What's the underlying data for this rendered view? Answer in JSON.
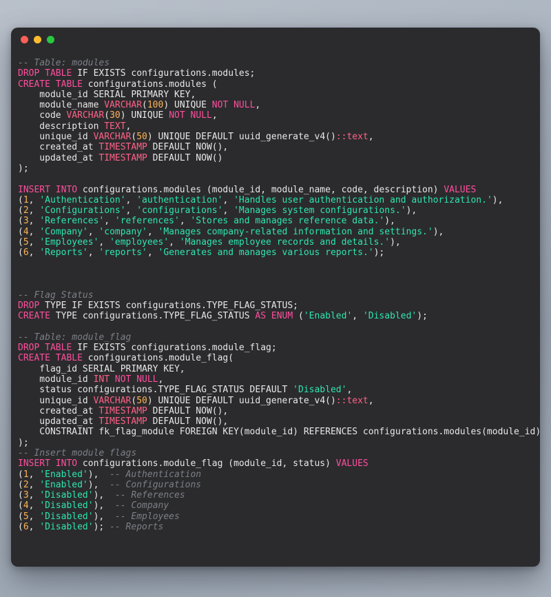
{
  "window": {
    "title": "",
    "traffic_lights": [
      {
        "name": "close",
        "color": "#ff5f57"
      },
      {
        "name": "minimize",
        "color": "#febc2e"
      },
      {
        "name": "maximize",
        "color": "#28c840"
      }
    ]
  },
  "theme": {
    "background_surface": "#2b2b2d",
    "desktop_gradient_start": "#b9c0ca",
    "desktop_gradient_end": "#a9b2bd",
    "keyword": "#ff4f9e",
    "type": "#ff6188",
    "string": "#2ee6b0",
    "number": "#ffb454",
    "comment": "#7b7f86",
    "plain": "#e8e8e8"
  },
  "code": {
    "language": "sql",
    "lines": [
      [
        {
          "t": "-- Table: modules",
          "c": "cmt"
        }
      ],
      [
        {
          "t": "DROP TABLE",
          "c": "kw"
        },
        {
          "t": " IF EXISTS configurations.modules;",
          "c": "pln"
        }
      ],
      [
        {
          "t": "CREATE TABLE",
          "c": "kw"
        },
        {
          "t": " configurations.modules (",
          "c": "pln"
        }
      ],
      [
        {
          "t": "    module_id SERIAL PRIMARY KEY,",
          "c": "pln"
        }
      ],
      [
        {
          "t": "    module_name ",
          "c": "pln"
        },
        {
          "t": "VARCHAR",
          "c": "typ"
        },
        {
          "t": "(",
          "c": "pln"
        },
        {
          "t": "100",
          "c": "num"
        },
        {
          "t": ") UNIQUE ",
          "c": "pln"
        },
        {
          "t": "NOT NULL",
          "c": "kw"
        },
        {
          "t": ",",
          "c": "pln"
        }
      ],
      [
        {
          "t": "    code ",
          "c": "pln"
        },
        {
          "t": "VARCHAR",
          "c": "typ"
        },
        {
          "t": "(",
          "c": "pln"
        },
        {
          "t": "30",
          "c": "num"
        },
        {
          "t": ") UNIQUE ",
          "c": "pln"
        },
        {
          "t": "NOT NULL",
          "c": "kw"
        },
        {
          "t": ",",
          "c": "pln"
        }
      ],
      [
        {
          "t": "    description ",
          "c": "pln"
        },
        {
          "t": "TEXT",
          "c": "typ"
        },
        {
          "t": ",",
          "c": "pln"
        }
      ],
      [
        {
          "t": "    unique_id ",
          "c": "pln"
        },
        {
          "t": "VARCHAR",
          "c": "typ"
        },
        {
          "t": "(",
          "c": "pln"
        },
        {
          "t": "50",
          "c": "num"
        },
        {
          "t": ") UNIQUE DEFAULT uuid_generate_v4()",
          "c": "pln"
        },
        {
          "t": "::text",
          "c": "typ"
        },
        {
          "t": ",",
          "c": "pln"
        }
      ],
      [
        {
          "t": "    created_at ",
          "c": "pln"
        },
        {
          "t": "TIMESTAMP",
          "c": "typ"
        },
        {
          "t": " DEFAULT NOW(),",
          "c": "pln"
        }
      ],
      [
        {
          "t": "    updated_at ",
          "c": "pln"
        },
        {
          "t": "TIMESTAMP",
          "c": "typ"
        },
        {
          "t": " DEFAULT NOW()",
          "c": "pln"
        }
      ],
      [
        {
          "t": ");",
          "c": "pln"
        }
      ],
      [],
      [
        {
          "t": "INSERT INTO",
          "c": "kw"
        },
        {
          "t": " configurations.modules (module_id, module_name, code, description) ",
          "c": "pln"
        },
        {
          "t": "VALUES",
          "c": "kw"
        }
      ],
      [
        {
          "t": "(",
          "c": "pln"
        },
        {
          "t": "1",
          "c": "num"
        },
        {
          "t": ", ",
          "c": "pln"
        },
        {
          "t": "'Authentication'",
          "c": "str"
        },
        {
          "t": ", ",
          "c": "pln"
        },
        {
          "t": "'authentication'",
          "c": "str"
        },
        {
          "t": ", ",
          "c": "pln"
        },
        {
          "t": "'Handles user authentication and authorization.'",
          "c": "str"
        },
        {
          "t": "),",
          "c": "pln"
        }
      ],
      [
        {
          "t": "(",
          "c": "pln"
        },
        {
          "t": "2",
          "c": "num"
        },
        {
          "t": ", ",
          "c": "pln"
        },
        {
          "t": "'Configurations'",
          "c": "str"
        },
        {
          "t": ", ",
          "c": "pln"
        },
        {
          "t": "'configurations'",
          "c": "str"
        },
        {
          "t": ", ",
          "c": "pln"
        },
        {
          "t": "'Manages system configurations.'",
          "c": "str"
        },
        {
          "t": "),",
          "c": "pln"
        }
      ],
      [
        {
          "t": "(",
          "c": "pln"
        },
        {
          "t": "3",
          "c": "num"
        },
        {
          "t": ", ",
          "c": "pln"
        },
        {
          "t": "'References'",
          "c": "str"
        },
        {
          "t": ", ",
          "c": "pln"
        },
        {
          "t": "'references'",
          "c": "str"
        },
        {
          "t": ", ",
          "c": "pln"
        },
        {
          "t": "'Stores and manages reference data.'",
          "c": "str"
        },
        {
          "t": "),",
          "c": "pln"
        }
      ],
      [
        {
          "t": "(",
          "c": "pln"
        },
        {
          "t": "4",
          "c": "num"
        },
        {
          "t": ", ",
          "c": "pln"
        },
        {
          "t": "'Company'",
          "c": "str"
        },
        {
          "t": ", ",
          "c": "pln"
        },
        {
          "t": "'company'",
          "c": "str"
        },
        {
          "t": ", ",
          "c": "pln"
        },
        {
          "t": "'Manages company-related information and settings.'",
          "c": "str"
        },
        {
          "t": "),",
          "c": "pln"
        }
      ],
      [
        {
          "t": "(",
          "c": "pln"
        },
        {
          "t": "5",
          "c": "num"
        },
        {
          "t": ", ",
          "c": "pln"
        },
        {
          "t": "'Employees'",
          "c": "str"
        },
        {
          "t": ", ",
          "c": "pln"
        },
        {
          "t": "'employees'",
          "c": "str"
        },
        {
          "t": ", ",
          "c": "pln"
        },
        {
          "t": "'Manages employee records and details.'",
          "c": "str"
        },
        {
          "t": "),",
          "c": "pln"
        }
      ],
      [
        {
          "t": "(",
          "c": "pln"
        },
        {
          "t": "6",
          "c": "num"
        },
        {
          "t": ", ",
          "c": "pln"
        },
        {
          "t": "'Reports'",
          "c": "str"
        },
        {
          "t": ", ",
          "c": "pln"
        },
        {
          "t": "'reports'",
          "c": "str"
        },
        {
          "t": ", ",
          "c": "pln"
        },
        {
          "t": "'Generates and manages various reports.'",
          "c": "str"
        },
        {
          "t": ");",
          "c": "pln"
        }
      ],
      [],
      [],
      [],
      [
        {
          "t": "-- Flag Status",
          "c": "cmt"
        }
      ],
      [
        {
          "t": "DROP",
          "c": "kw"
        },
        {
          "t": " TYPE IF EXISTS configurations.TYPE_FLAG_STATUS;",
          "c": "pln"
        }
      ],
      [
        {
          "t": "CREATE",
          "c": "kw"
        },
        {
          "t": " TYPE configurations.TYPE_FLAG_STATUS ",
          "c": "pln"
        },
        {
          "t": "AS ENUM",
          "c": "kw"
        },
        {
          "t": " (",
          "c": "pln"
        },
        {
          "t": "'Enabled'",
          "c": "str"
        },
        {
          "t": ", ",
          "c": "pln"
        },
        {
          "t": "'Disabled'",
          "c": "str"
        },
        {
          "t": ");",
          "c": "pln"
        }
      ],
      [],
      [
        {
          "t": "-- Table: module_flag",
          "c": "cmt"
        }
      ],
      [
        {
          "t": "DROP TABLE",
          "c": "kw"
        },
        {
          "t": " IF EXISTS configurations.module_flag;",
          "c": "pln"
        }
      ],
      [
        {
          "t": "CREATE TABLE",
          "c": "kw"
        },
        {
          "t": " configurations.module_flag(",
          "c": "pln"
        }
      ],
      [
        {
          "t": "    flag_id SERIAL PRIMARY KEY,",
          "c": "pln"
        }
      ],
      [
        {
          "t": "    module_id ",
          "c": "pln"
        },
        {
          "t": "INT",
          "c": "typ"
        },
        {
          "t": " ",
          "c": "pln"
        },
        {
          "t": "NOT NULL",
          "c": "kw"
        },
        {
          "t": ",",
          "c": "pln"
        }
      ],
      [
        {
          "t": "    status configurations.TYPE_FLAG_STATUS DEFAULT ",
          "c": "pln"
        },
        {
          "t": "'Disabled'",
          "c": "str"
        },
        {
          "t": ",",
          "c": "pln"
        }
      ],
      [
        {
          "t": "    unique_id ",
          "c": "pln"
        },
        {
          "t": "VARCHAR",
          "c": "typ"
        },
        {
          "t": "(",
          "c": "pln"
        },
        {
          "t": "50",
          "c": "num"
        },
        {
          "t": ") UNIQUE DEFAULT uuid_generate_v4()",
          "c": "pln"
        },
        {
          "t": "::text",
          "c": "typ"
        },
        {
          "t": ",",
          "c": "pln"
        }
      ],
      [
        {
          "t": "    created_at ",
          "c": "pln"
        },
        {
          "t": "TIMESTAMP",
          "c": "typ"
        },
        {
          "t": " DEFAULT NOW(),",
          "c": "pln"
        }
      ],
      [
        {
          "t": "    updated_at ",
          "c": "pln"
        },
        {
          "t": "TIMESTAMP",
          "c": "typ"
        },
        {
          "t": " DEFAULT NOW(),",
          "c": "pln"
        }
      ],
      [
        {
          "t": "    CONSTRAINT fk_flag_module FOREIGN KEY(module_id) REFERENCES configurations.modules(module_id)",
          "c": "pln"
        }
      ],
      [
        {
          "t": ");",
          "c": "pln"
        }
      ],
      [
        {
          "t": "-- Insert module flags",
          "c": "cmt"
        }
      ],
      [
        {
          "t": "INSERT INTO",
          "c": "kw"
        },
        {
          "t": " configurations.module_flag (module_id, status) ",
          "c": "pln"
        },
        {
          "t": "VALUES",
          "c": "kw"
        }
      ],
      [
        {
          "t": "(",
          "c": "pln"
        },
        {
          "t": "1",
          "c": "num"
        },
        {
          "t": ", ",
          "c": "pln"
        },
        {
          "t": "'Enabled'",
          "c": "str"
        },
        {
          "t": "),  ",
          "c": "pln"
        },
        {
          "t": "-- Authentication",
          "c": "cmt"
        }
      ],
      [
        {
          "t": "(",
          "c": "pln"
        },
        {
          "t": "2",
          "c": "num"
        },
        {
          "t": ", ",
          "c": "pln"
        },
        {
          "t": "'Enabled'",
          "c": "str"
        },
        {
          "t": "),  ",
          "c": "pln"
        },
        {
          "t": "-- Configurations",
          "c": "cmt"
        }
      ],
      [
        {
          "t": "(",
          "c": "pln"
        },
        {
          "t": "3",
          "c": "num"
        },
        {
          "t": ", ",
          "c": "pln"
        },
        {
          "t": "'Disabled'",
          "c": "str"
        },
        {
          "t": "),  ",
          "c": "pln"
        },
        {
          "t": "-- References",
          "c": "cmt"
        }
      ],
      [
        {
          "t": "(",
          "c": "pln"
        },
        {
          "t": "4",
          "c": "num"
        },
        {
          "t": ", ",
          "c": "pln"
        },
        {
          "t": "'Disabled'",
          "c": "str"
        },
        {
          "t": "),  ",
          "c": "pln"
        },
        {
          "t": "-- Company",
          "c": "cmt"
        }
      ],
      [
        {
          "t": "(",
          "c": "pln"
        },
        {
          "t": "5",
          "c": "num"
        },
        {
          "t": ", ",
          "c": "pln"
        },
        {
          "t": "'Disabled'",
          "c": "str"
        },
        {
          "t": "),  ",
          "c": "pln"
        },
        {
          "t": "-- Employees",
          "c": "cmt"
        }
      ],
      [
        {
          "t": "(",
          "c": "pln"
        },
        {
          "t": "6",
          "c": "num"
        },
        {
          "t": ", ",
          "c": "pln"
        },
        {
          "t": "'Disabled'",
          "c": "str"
        },
        {
          "t": "); ",
          "c": "pln"
        },
        {
          "t": "-- Reports",
          "c": "cmt"
        }
      ]
    ]
  }
}
